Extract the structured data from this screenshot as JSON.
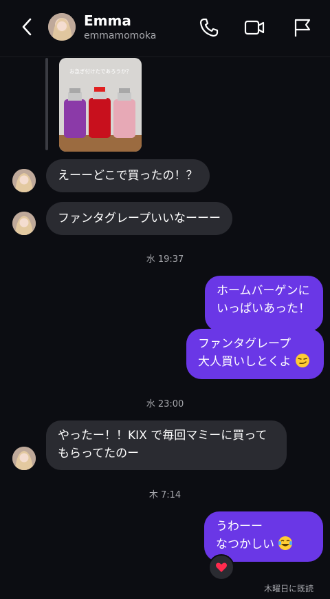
{
  "header": {
    "name": "Emma",
    "handle": "emmamomoka"
  },
  "story": {
    "caption": "お急ぎ付けたであろうか？"
  },
  "messages": [
    {
      "side": "in",
      "text": "えーーどこで買ったの！？"
    },
    {
      "side": "in",
      "text": "ファンタグレープいいなーーー"
    },
    {
      "side": "out",
      "line1": "ホームバーゲンに",
      "line2": "いっぱいあった！"
    },
    {
      "side": "out",
      "line1": "ファンタグレープ",
      "line2": "大人買いしとくよ"
    },
    {
      "side": "in",
      "line1": "やったー！！KIX で毎回マミーに買って",
      "line2": "もらってたのー"
    },
    {
      "side": "out",
      "line1": "うわーー",
      "line2": "なつかしい"
    }
  ],
  "timestamps": {
    "t1": "水 19:37",
    "t2": "水 23:00",
    "t3": "木 7:14"
  },
  "reaction": "heart-emoji",
  "seen": "木曜日に既読",
  "colors": {
    "background": "#0c0d12",
    "incoming_bubble": "#2a2b31",
    "outgoing_bubble": "#6a37e6"
  }
}
